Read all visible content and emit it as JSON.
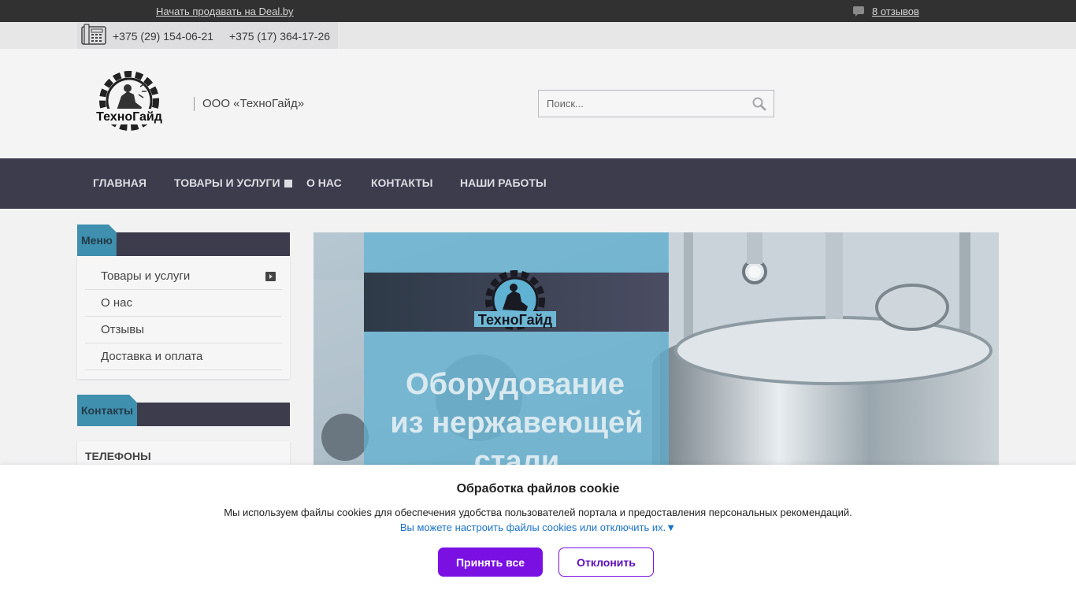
{
  "topbar": {
    "sell_link": "Начать продавать на Deal.by",
    "reviews_link": "8 отзывов"
  },
  "phones": {
    "primary": "+375 (29) 154-06-21",
    "secondary": "+375 (17) 364-17-26"
  },
  "header": {
    "logo_text": "ТехноГайд",
    "company_name": "ООО «ТехноГайд»",
    "search_placeholder": "Поиск..."
  },
  "nav": {
    "items": [
      {
        "label": "Главная"
      },
      {
        "label": "Товары и услуги"
      },
      {
        "label": "О нас"
      },
      {
        "label": "Контакты"
      },
      {
        "label": "Наши работы"
      }
    ]
  },
  "sidebar": {
    "menu_title": "Меню",
    "menu_items": [
      {
        "label": "Товары и услуги"
      },
      {
        "label": "О нас"
      },
      {
        "label": "Отзывы"
      },
      {
        "label": "Доставка и оплата"
      }
    ],
    "contacts_title": "Контакты",
    "phones_title": "ТЕЛЕФОНЫ"
  },
  "banner": {
    "logo_text": "ТехноГайд",
    "line1": "Оборудование",
    "line2": "из нержавеющей",
    "line3": "стали"
  },
  "cookie": {
    "title": "Обработка файлов cookie",
    "text": "Мы используем файлы cookies для обеспечения удобства пользователей портала и предоставления персональных рекомендаций.",
    "settings_link": "Вы можете настроить файлы cookies или отключить их.▼",
    "accept_label": "Принять все",
    "decline_label": "Отклонить"
  },
  "colors": {
    "topbar": "#313132",
    "nav": "#3d3c4d",
    "accent_tab": "#3f8fae",
    "cookie_button": "#7b10e3",
    "link_blue": "#1a73c9"
  },
  "icons": {
    "reviews": "speech-bubble-icon",
    "phone": "phone-icon",
    "search": "magnifier-icon",
    "dropdown": "square-icon",
    "submenu": "chevron-right-icon"
  }
}
